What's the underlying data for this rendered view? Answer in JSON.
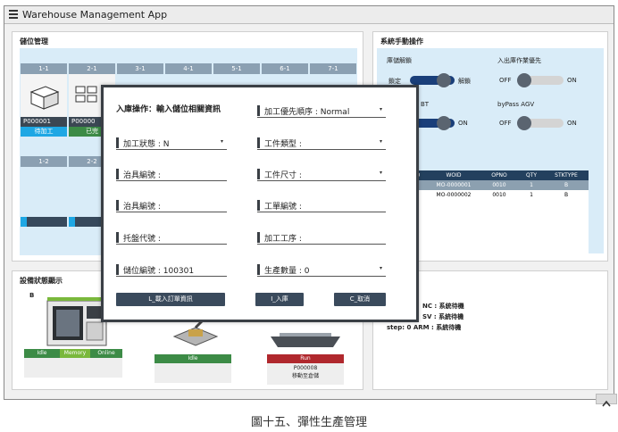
{
  "app": {
    "title": "Warehouse Management App"
  },
  "storage": {
    "title": "儲位管理",
    "row1": [
      {
        "head": "1-1",
        "id": "P000001",
        "status": "待加工"
      },
      {
        "head": "2-1",
        "id": "P00000",
        "status": "已完"
      },
      {
        "head": "3-1"
      },
      {
        "head": "4-1"
      },
      {
        "head": "5-1"
      },
      {
        "head": "6-1"
      },
      {
        "head": "7-1"
      }
    ],
    "row2": [
      {
        "head": "1-2"
      },
      {
        "head": "2-2"
      }
    ]
  },
  "control": {
    "title": "系統手動操作",
    "lock_label": "庫儲解鎖",
    "lock_left": "鎖定",
    "lock_right": "解鎖",
    "priority_label": "入出庫作業優先",
    "off": "OFF",
    "on": "ON",
    "bt_label": "BT",
    "agv_label": "byPass AGV"
  },
  "table": {
    "headers": [
      "O",
      "WOID",
      "OPNO",
      "QTY",
      "STKTYPE"
    ],
    "rows": [
      {
        "o": "",
        "woid": "MO-0000001",
        "opno": "0010",
        "qty": "1",
        "stk": "B"
      },
      {
        "o": "",
        "woid": "MO-0000002",
        "opno": "0010",
        "qty": "1",
        "stk": "B"
      }
    ]
  },
  "devices": {
    "title": "設備狀態顯示",
    "b_label": "B",
    "cnc_status": [
      "Idle",
      "Memory",
      "Online"
    ],
    "robot_status": "Idle",
    "agv_status": "Run",
    "agv_id": "P000008",
    "agv_action": "移動至倉儲"
  },
  "status_lines": {
    "line1": "NC : 系統待機",
    "line2": "SV : 系統待機",
    "line3": "step: 0  ARM : 系統待機"
  },
  "modal": {
    "heading": "入庫操作：輸入儲位相關資訊",
    "priority": "加工優先順序 : Normal",
    "process_status": "加工狀態 : N",
    "work_type": "工件類型 :",
    "fixture_no": "治具編號 :",
    "work_size": "工件尺寸 :",
    "fixture_no2": "治具編號 :",
    "order_no": "工單編號 :",
    "pallet_code": "托盤代號 :",
    "process_step": "加工工序 :",
    "location_no": "儲位編號 : 100301",
    "quantity": "生產數量 : 0",
    "btn_load": "L_載入訂單資訊",
    "btn_store": "I_入庫",
    "btn_cancel": "C_取消"
  },
  "caption": "圖十五、彈性生產管理",
  "colors": {
    "accent": "#1ea7e4",
    "dark": "#2e3b49",
    "panel_blue": "#d9ecf8",
    "idle_green": "#3c8b46",
    "run_red": "#b0282d"
  }
}
